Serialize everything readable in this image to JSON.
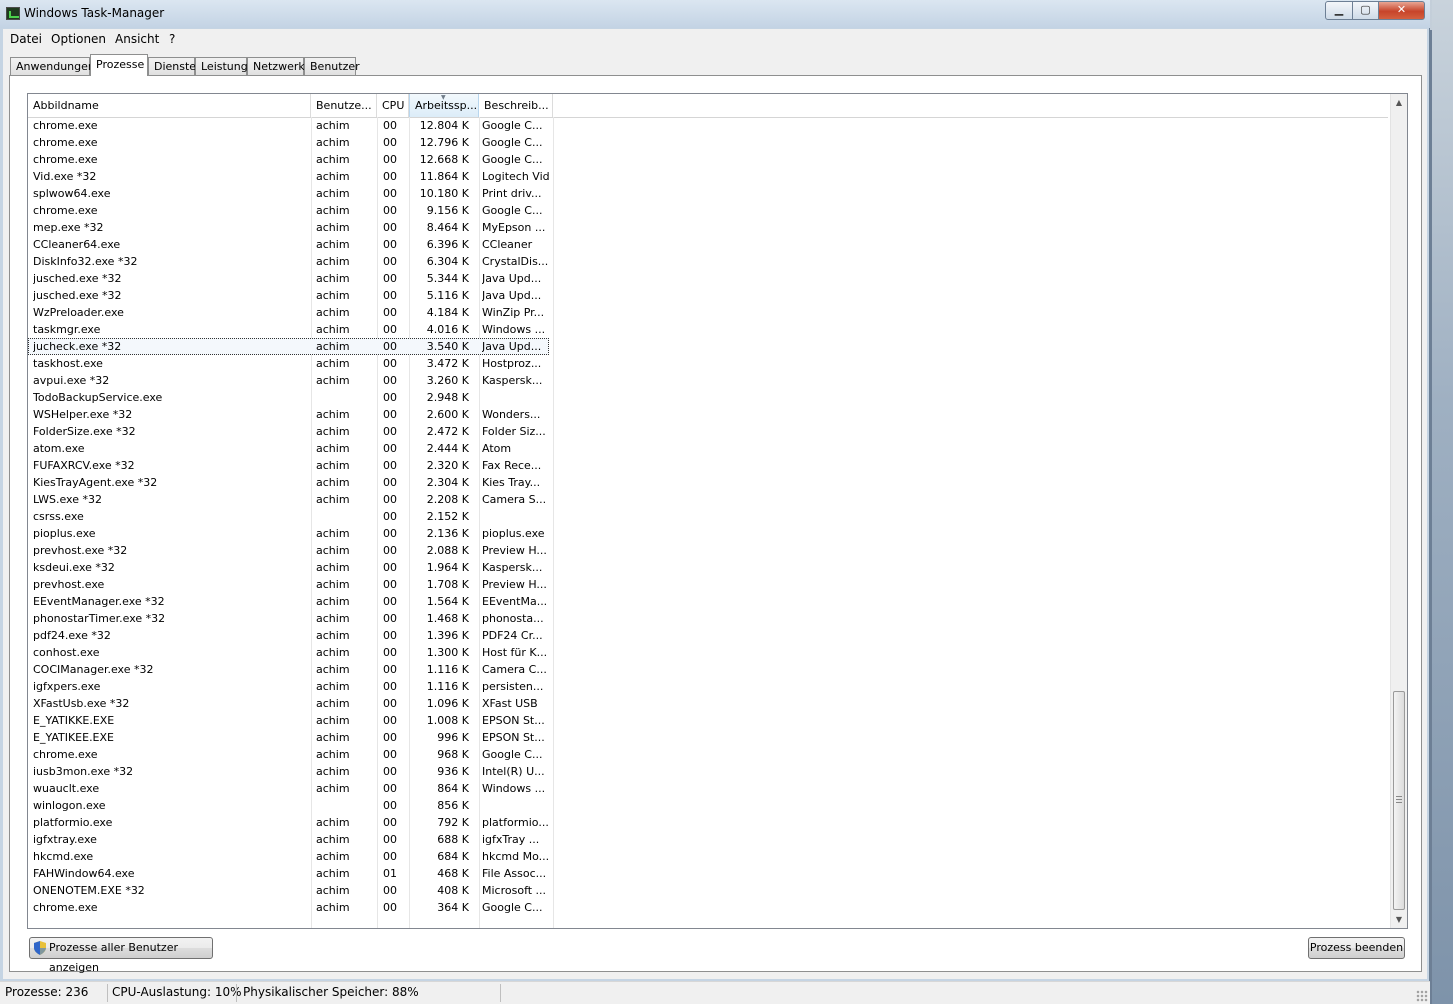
{
  "window": {
    "title": "Windows Task-Manager",
    "controls": {
      "minimize": "▁",
      "maximize": "▢",
      "close": "✕"
    }
  },
  "menu": [
    "Datei",
    "Optionen",
    "Ansicht",
    "?"
  ],
  "tabs": [
    "Anwendungen",
    "Prozesse",
    "Dienste",
    "Leistung",
    "Netzwerk",
    "Benutzer"
  ],
  "active_tab": "Prozesse",
  "columns": [
    "Abbildname",
    "Benutze...",
    "CPU",
    "Arbeitssp...",
    "Beschreib..."
  ],
  "processes": [
    {
      "name": "chrome.exe",
      "user": "achim",
      "cpu": "00",
      "mem": "12.804 K",
      "desc": "Google C..."
    },
    {
      "name": "chrome.exe",
      "user": "achim",
      "cpu": "00",
      "mem": "12.796 K",
      "desc": "Google C..."
    },
    {
      "name": "chrome.exe",
      "user": "achim",
      "cpu": "00",
      "mem": "12.668 K",
      "desc": "Google C..."
    },
    {
      "name": "Vid.exe *32",
      "user": "achim",
      "cpu": "00",
      "mem": "11.864 K",
      "desc": "Logitech Vid"
    },
    {
      "name": "splwow64.exe",
      "user": "achim",
      "cpu": "00",
      "mem": "10.180 K",
      "desc": "Print driv..."
    },
    {
      "name": "chrome.exe",
      "user": "achim",
      "cpu": "00",
      "mem": "9.156 K",
      "desc": "Google C..."
    },
    {
      "name": "mep.exe *32",
      "user": "achim",
      "cpu": "00",
      "mem": "8.464 K",
      "desc": "MyEpson ..."
    },
    {
      "name": "CCleaner64.exe",
      "user": "achim",
      "cpu": "00",
      "mem": "6.396 K",
      "desc": "CCleaner"
    },
    {
      "name": "DiskInfo32.exe *32",
      "user": "achim",
      "cpu": "00",
      "mem": "6.304 K",
      "desc": "CrystalDis..."
    },
    {
      "name": "jusched.exe *32",
      "user": "achim",
      "cpu": "00",
      "mem": "5.344 K",
      "desc": "Java Upd..."
    },
    {
      "name": "jusched.exe *32",
      "user": "achim",
      "cpu": "00",
      "mem": "5.116 K",
      "desc": "Java Upd..."
    },
    {
      "name": "WzPreloader.exe",
      "user": "achim",
      "cpu": "00",
      "mem": "4.184 K",
      "desc": "WinZip Pr..."
    },
    {
      "name": "taskmgr.exe",
      "user": "achim",
      "cpu": "00",
      "mem": "4.016 K",
      "desc": "Windows ..."
    },
    {
      "name": "jucheck.exe *32",
      "user": "achim",
      "cpu": "00",
      "mem": "3.540 K",
      "desc": "Java Upd..."
    },
    {
      "name": "taskhost.exe",
      "user": "achim",
      "cpu": "00",
      "mem": "3.472 K",
      "desc": "Hostproz..."
    },
    {
      "name": "avpui.exe *32",
      "user": "achim",
      "cpu": "00",
      "mem": "3.260 K",
      "desc": "Kaspersk..."
    },
    {
      "name": "TodoBackupService.exe",
      "user": "",
      "cpu": "00",
      "mem": "2.948 K",
      "desc": ""
    },
    {
      "name": "WSHelper.exe *32",
      "user": "achim",
      "cpu": "00",
      "mem": "2.600 K",
      "desc": "Wonders..."
    },
    {
      "name": "FolderSize.exe *32",
      "user": "achim",
      "cpu": "00",
      "mem": "2.472 K",
      "desc": "Folder Siz..."
    },
    {
      "name": "atom.exe",
      "user": "achim",
      "cpu": "00",
      "mem": "2.444 K",
      "desc": "Atom"
    },
    {
      "name": "FUFAXRCV.exe *32",
      "user": "achim",
      "cpu": "00",
      "mem": "2.320 K",
      "desc": "Fax Rece..."
    },
    {
      "name": "KiesTrayAgent.exe *32",
      "user": "achim",
      "cpu": "00",
      "mem": "2.304 K",
      "desc": "Kies Tray..."
    },
    {
      "name": "LWS.exe *32",
      "user": "achim",
      "cpu": "00",
      "mem": "2.208 K",
      "desc": "Camera S..."
    },
    {
      "name": "csrss.exe",
      "user": "",
      "cpu": "00",
      "mem": "2.152 K",
      "desc": ""
    },
    {
      "name": "pioplus.exe",
      "user": "achim",
      "cpu": "00",
      "mem": "2.136 K",
      "desc": "pioplus.exe"
    },
    {
      "name": "prevhost.exe *32",
      "user": "achim",
      "cpu": "00",
      "mem": "2.088 K",
      "desc": "Preview H..."
    },
    {
      "name": "ksdeui.exe *32",
      "user": "achim",
      "cpu": "00",
      "mem": "1.964 K",
      "desc": "Kaspersk..."
    },
    {
      "name": "prevhost.exe",
      "user": "achim",
      "cpu": "00",
      "mem": "1.708 K",
      "desc": "Preview H..."
    },
    {
      "name": "EEventManager.exe *32",
      "user": "achim",
      "cpu": "00",
      "mem": "1.564 K",
      "desc": "EEventMa..."
    },
    {
      "name": "phonostarTimer.exe *32",
      "user": "achim",
      "cpu": "00",
      "mem": "1.468 K",
      "desc": "phonosta..."
    },
    {
      "name": "pdf24.exe *32",
      "user": "achim",
      "cpu": "00",
      "mem": "1.396 K",
      "desc": "PDF24 Cr..."
    },
    {
      "name": "conhost.exe",
      "user": "achim",
      "cpu": "00",
      "mem": "1.300 K",
      "desc": "Host für K..."
    },
    {
      "name": "COCIManager.exe *32",
      "user": "achim",
      "cpu": "00",
      "mem": "1.116 K",
      "desc": "Camera C..."
    },
    {
      "name": "igfxpers.exe",
      "user": "achim",
      "cpu": "00",
      "mem": "1.116 K",
      "desc": "persisten..."
    },
    {
      "name": "XFastUsb.exe *32",
      "user": "achim",
      "cpu": "00",
      "mem": "1.096 K",
      "desc": "XFast USB"
    },
    {
      "name": "E_YATIKKE.EXE",
      "user": "achim",
      "cpu": "00",
      "mem": "1.008 K",
      "desc": "EPSON St..."
    },
    {
      "name": "E_YATIKEE.EXE",
      "user": "achim",
      "cpu": "00",
      "mem": "996 K",
      "desc": "EPSON St..."
    },
    {
      "name": "chrome.exe",
      "user": "achim",
      "cpu": "00",
      "mem": "968 K",
      "desc": "Google C..."
    },
    {
      "name": "iusb3mon.exe *32",
      "user": "achim",
      "cpu": "00",
      "mem": "936 K",
      "desc": "Intel(R) U..."
    },
    {
      "name": "wuauclt.exe",
      "user": "achim",
      "cpu": "00",
      "mem": "864 K",
      "desc": "Windows ..."
    },
    {
      "name": "winlogon.exe",
      "user": "",
      "cpu": "00",
      "mem": "856 K",
      "desc": ""
    },
    {
      "name": "platformio.exe",
      "user": "achim",
      "cpu": "00",
      "mem": "792 K",
      "desc": "platformio..."
    },
    {
      "name": "igfxtray.exe",
      "user": "achim",
      "cpu": "00",
      "mem": "688 K",
      "desc": "igfxTray ..."
    },
    {
      "name": "hkcmd.exe",
      "user": "achim",
      "cpu": "00",
      "mem": "684 K",
      "desc": "hkcmd Mo..."
    },
    {
      "name": "FAHWindow64.exe",
      "user": "achim",
      "cpu": "01",
      "mem": "468 K",
      "desc": "File Assoc..."
    },
    {
      "name": "ONENOTEM.EXE *32",
      "user": "achim",
      "cpu": "00",
      "mem": "408 K",
      "desc": "Microsoft ..."
    },
    {
      "name": "chrome.exe",
      "user": "achim",
      "cpu": "00",
      "mem": "364 K",
      "desc": "Google C..."
    }
  ],
  "selected_index": 13,
  "buttons": {
    "show_all_users": "Prozesse aller Benutzer anzeigen",
    "end_process": "Prozess beenden"
  },
  "status": {
    "processes": "Prozesse: 236",
    "cpu": "CPU-Auslastung: 10%",
    "memory": "Physikalischer Speicher: 88%"
  }
}
